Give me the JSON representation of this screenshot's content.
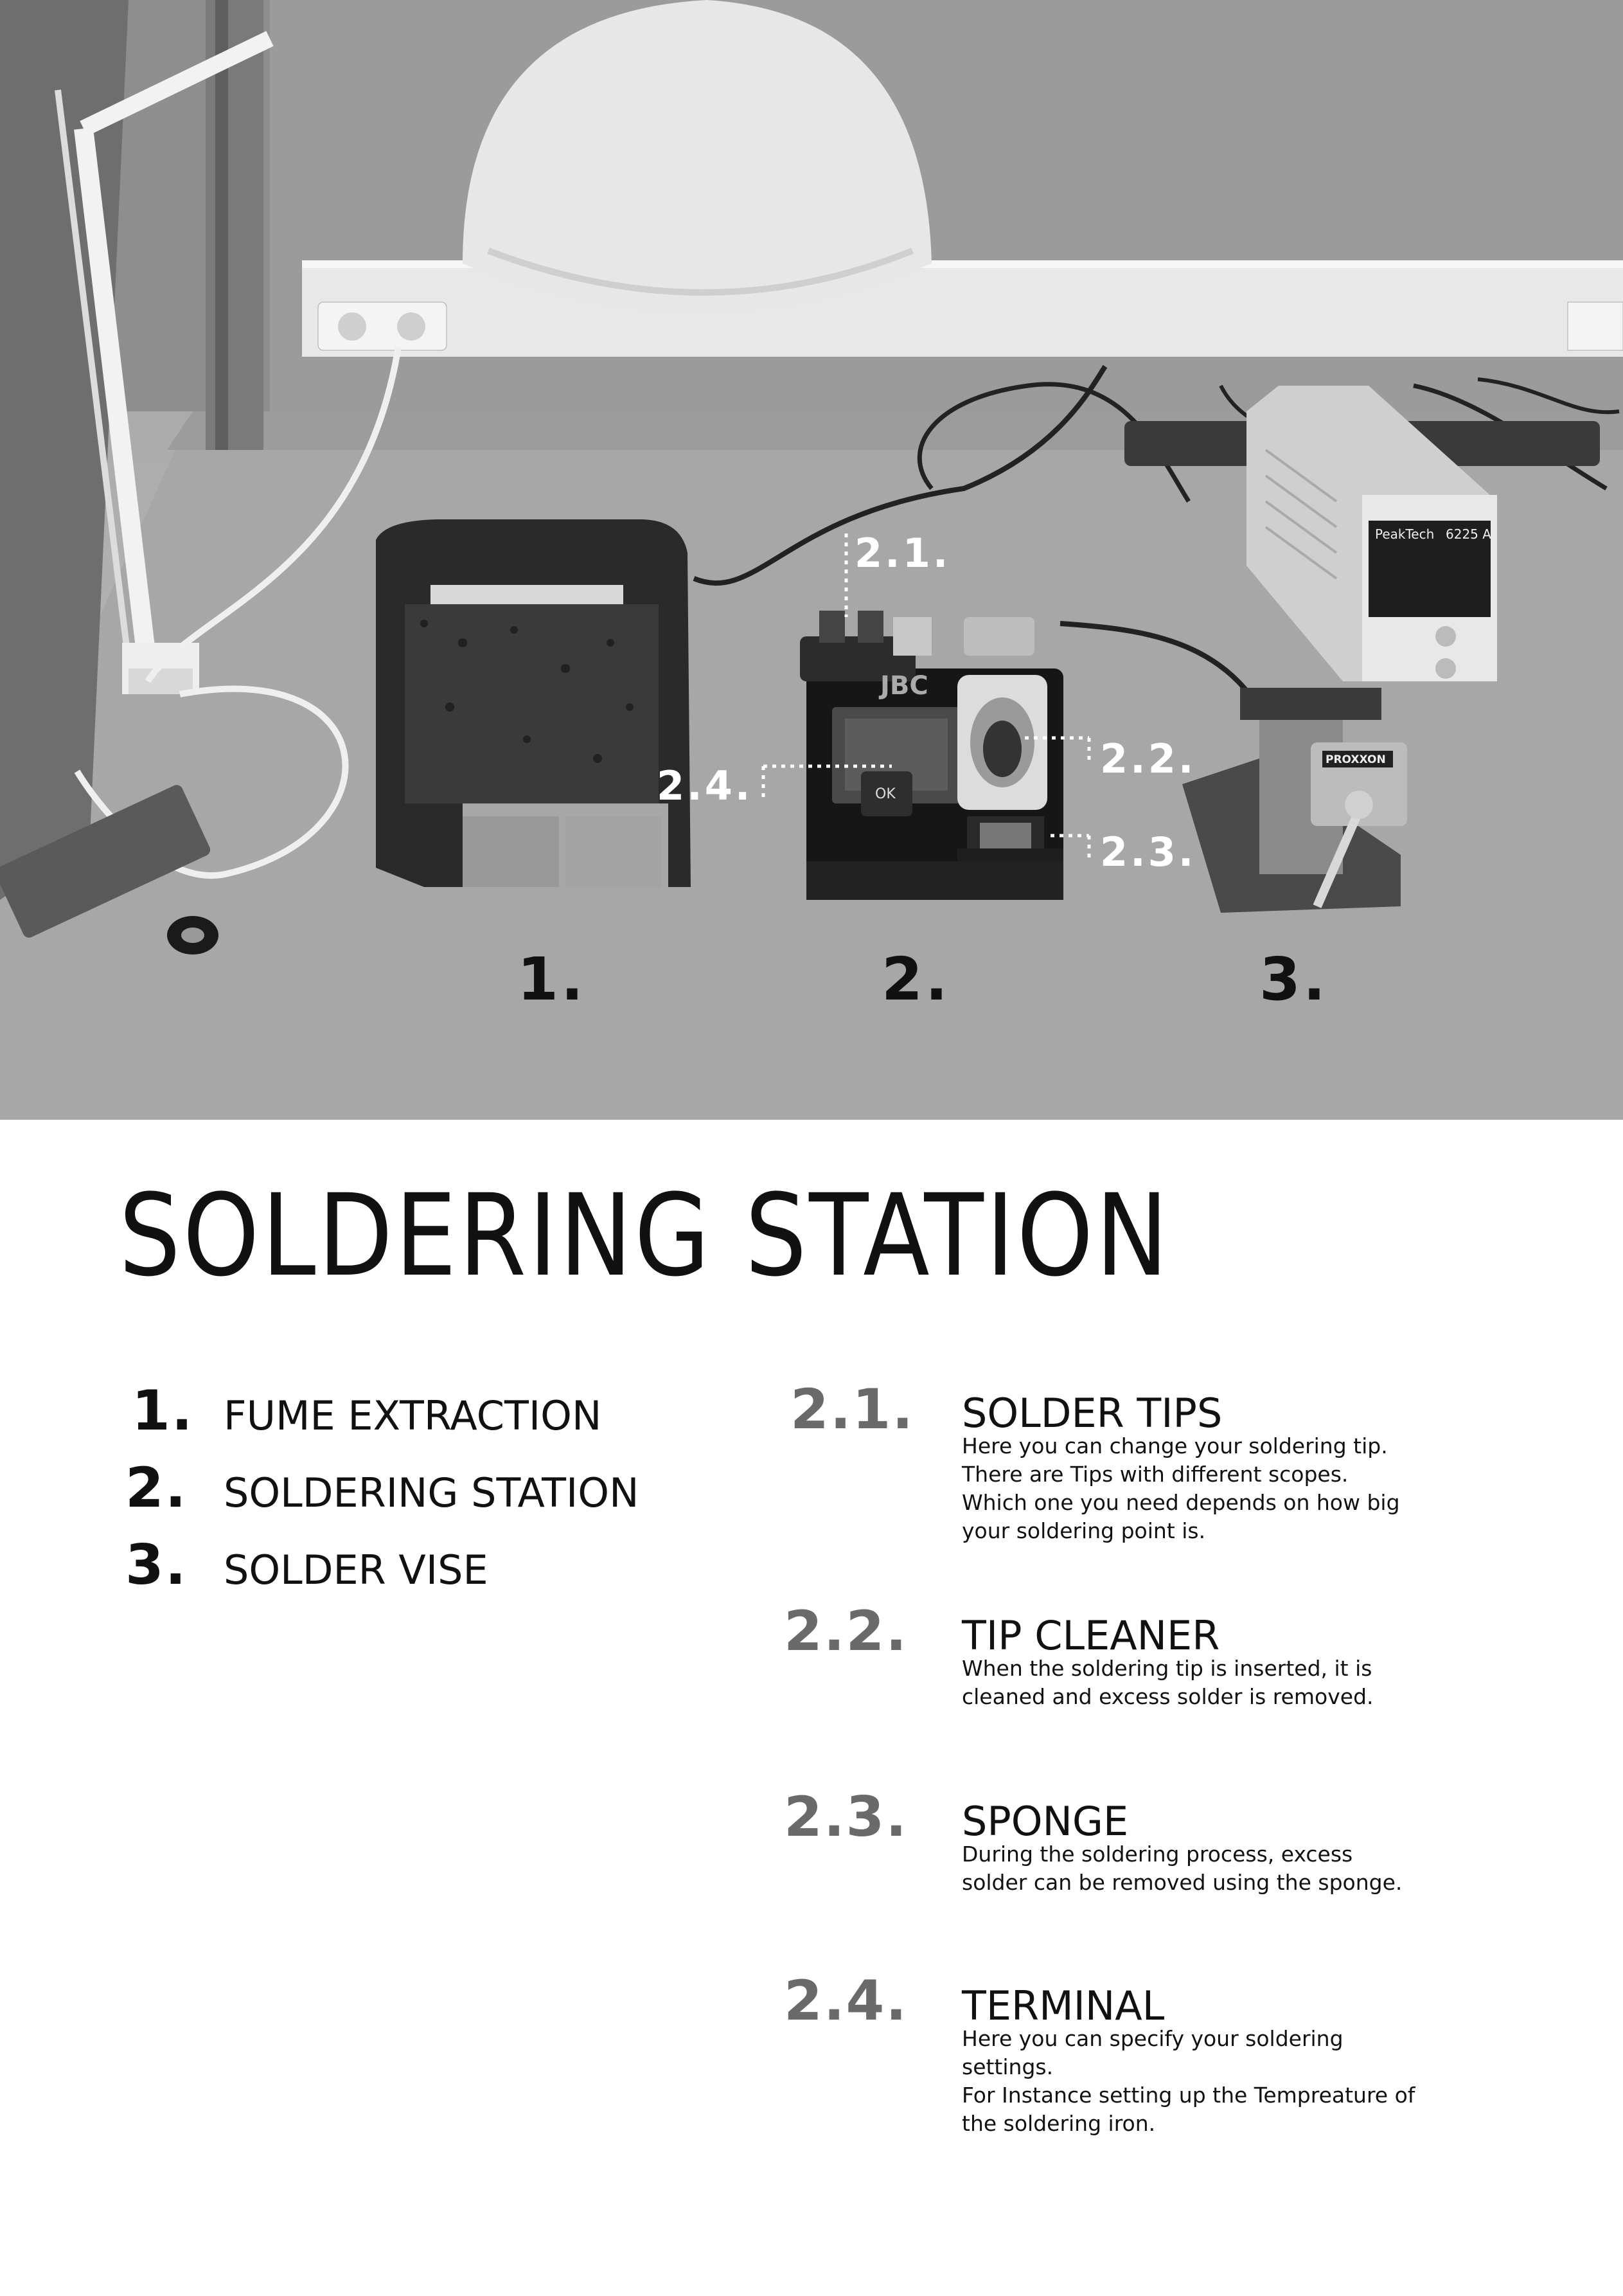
{
  "photo": {
    "callouts": {
      "c21": "2.1.",
      "c22": "2.2.",
      "c23": "2.3.",
      "c24": "2.4."
    },
    "numbers": {
      "n1": "1.",
      "n2": "2.",
      "n3": "3."
    },
    "device_labels": {
      "station_brand": "JBC",
      "vise_brand": "PROXXON",
      "psu_brand": "PeakTech",
      "psu_model": "6225 A",
      "ok_button": "OK"
    }
  },
  "title": "SOLDERING STATION",
  "overview": [
    {
      "num": "1.",
      "label": "FUME EXTRACTION"
    },
    {
      "num": "2.",
      "label": "SOLDERING STATION"
    },
    {
      "num": "3.",
      "label": "SOLDER VISE"
    }
  ],
  "details": [
    {
      "num": "2.1.",
      "heading": "SOLDER TIPS",
      "text": "Here you can change your soldering tip.\nThere are Tips with different scopes.\nWhich one you need depends on how big\nyour soldering point is."
    },
    {
      "num": "2.2.",
      "heading": "TIP CLEANER",
      "text": "When the soldering tip is inserted, it is\ncleaned and excess solder is removed."
    },
    {
      "num": "2.3.",
      "heading": "SPONGE",
      "text": "During the soldering process, excess\nsolder can be removed using the sponge."
    },
    {
      "num": "2.4.",
      "heading": "TERMINAL",
      "text": "Here you can specify your soldering\nsettings.\nFor Instance setting up the Tempreature of\nthe soldering iron."
    }
  ],
  "colors": {
    "text_dark": "#111111",
    "detail_number_gray": "#6a6a6a",
    "callout_white": "#ffffff"
  }
}
